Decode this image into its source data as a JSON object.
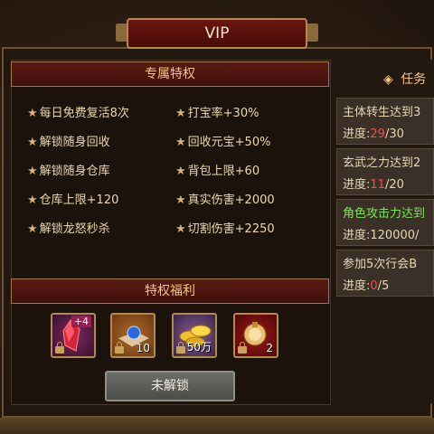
{
  "title": "VIP",
  "privileges": {
    "header": "专属特权",
    "items": [
      "每日免费复活8次",
      "解锁随身回收",
      "解锁随身仓库",
      "仓库上限+120",
      "解锁龙怒秒杀",
      "打宝率+30%",
      "回收元宝+50%",
      "背包上限+60",
      "真实伤害+2000",
      "切割伤害+2250"
    ]
  },
  "benefits": {
    "header": "特权福利",
    "slots": [
      {
        "icon": "red-crystal-icon",
        "badge": "+4",
        "count": ""
      },
      {
        "icon": "blue-orb-icon",
        "badge": "",
        "count": "10"
      },
      {
        "icon": "gold-ingot-icon",
        "badge": "",
        "count": "50万"
      },
      {
        "icon": "gold-pouch-icon",
        "badge": "",
        "count": "2"
      }
    ],
    "button": "未解锁"
  },
  "tasks": {
    "header": "任务",
    "progress_label": "进度:",
    "items": [
      {
        "name": "主体转生达到3",
        "current": "29",
        "total": "30",
        "highlight": false
      },
      {
        "name": "玄武之力达到2",
        "current": "11",
        "total": "20",
        "highlight": false
      },
      {
        "name": "角色攻击力达到",
        "current": "120000",
        "total": "",
        "highlight": true
      },
      {
        "name": "参加5次行会B",
        "current": "0",
        "total": "5",
        "highlight": false
      }
    ]
  },
  "colors": {
    "accent": "#f4c882",
    "progress_current": "#ff4a3c",
    "task_highlight": "#7ee35c"
  }
}
